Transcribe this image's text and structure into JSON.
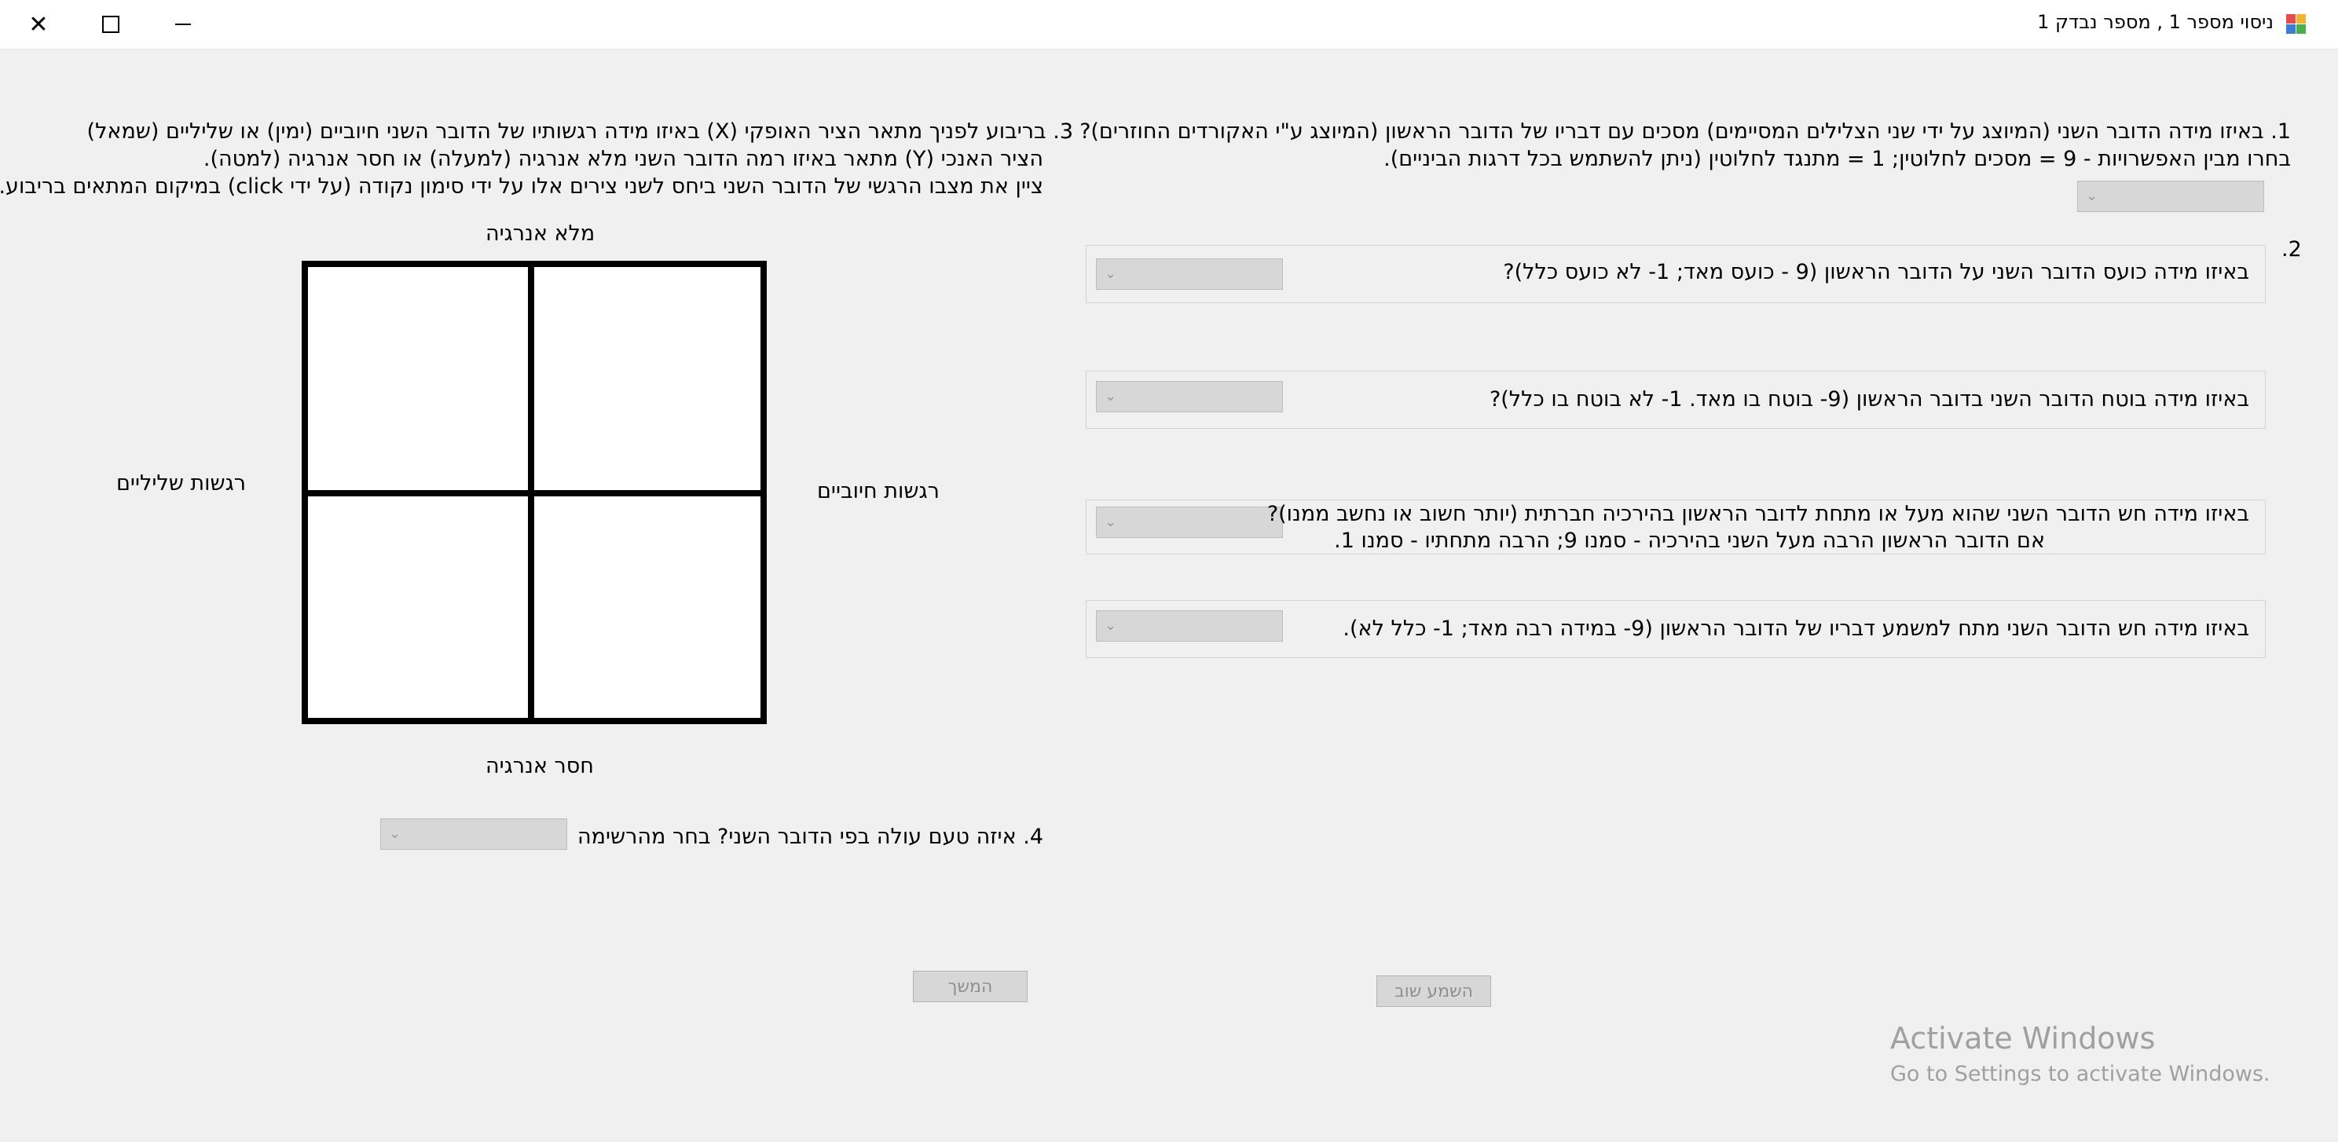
{
  "window": {
    "title": "ניסוי מספר 1 , מספר נבדק 1",
    "icon": "app-icon",
    "controls": {
      "close": "✕",
      "maximize": "maximize-icon",
      "minimize": "minimize-icon"
    }
  },
  "questions": {
    "q1": {
      "line1": "1. באיזו מידה הדובר השני (המיוצג  על ידי  שני הצלילים המסיימים) מסכים עם דבריו של הדובר הראשון (המיוצג ע\"י האקורדים החוזרים)?",
      "line2": "בחרו מבין האפשרויות -  9 = מסכים לחלוטין; 1 = מתנגד לחלוטין (ניתן להשתמש בכל דרגות הביניים).",
      "selected": ""
    },
    "q2": {
      "number": ".2",
      "items": [
        {
          "text": "באיזו מידה כועס הדובר השני על הדובר הראשון (9 - כועס מאד; 1- לא כועס כלל)?",
          "selected": ""
        },
        {
          "text": "באיזו מידה בוטח הדובר השני בדובר הראשון (9- בוטח בו מאד. 1- לא בוטח בו כלל)?",
          "selected": ""
        },
        {
          "line1": "באיזו מידה חש הדובר השני שהוא מעל או מתחת לדובר הראשון בהירכיה חברתית (יותר חשוב או נחשב ממנו)?",
          "line2": "אם הדובר הראשון הרבה מעל השני בהירכיה -  סמנו  9; הרבה מתחתיו - סמנו 1.",
          "selected": ""
        },
        {
          "text": "באיזו מידה חש הדובר השני מתח למשמע דבריו של הדובר הראשון (9- במידה רבה מאד; 1- כלל לא).",
          "selected": ""
        }
      ]
    },
    "q3": {
      "line1": "3. בריבוע לפניך מתאר הציר האופקי (X) באיזו מידה רגשותיו של הדובר השני חיוביים (ימין) או שליליים (שמאל)",
      "line2": "הציר האנכי (Y) מתאר באיזו רמה הדובר השני מלא אנרגיה (למעלה) או חסר אנרגיה (למטה).",
      "line3": "ציין את מצבו הרגשי של הדובר השני ביחס לשני צירים אלו על ידי סימון נקודה (על ידי click) במיקום המתאים בריבוע.",
      "top_label": "מלא אנרגיה",
      "bottom_label": "חסר אנרגיה",
      "left_label": "רגשות שליליים",
      "right_label": "רגשות חיוביים"
    },
    "q4": {
      "text": "4. איזה טעם עולה בפי הדובר השני? בחר מהרשימה",
      "selected": ""
    }
  },
  "buttons": {
    "continue": "המשך",
    "replay": "השמע שוב"
  },
  "watermark": {
    "line1": "Activate Windows",
    "line2": "Go to Settings to activate Windows."
  },
  "colors": {
    "background": "#f0f0f0",
    "titlebar": "#ffffff",
    "disabled_control": "#d7d7d7",
    "grid_border": "#000000"
  }
}
